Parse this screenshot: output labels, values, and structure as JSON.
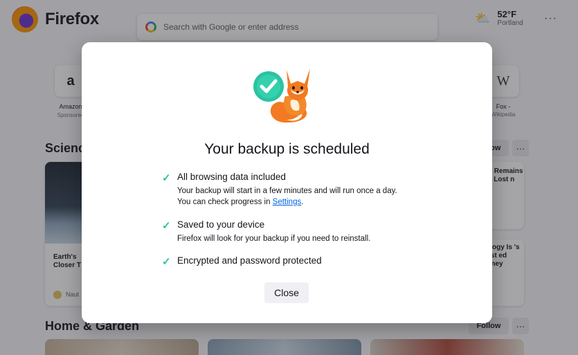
{
  "browser": {
    "name": "Firefox",
    "search_placeholder": "Search with Google or enter address",
    "weather": {
      "temp": "52°F",
      "city": "Portland"
    }
  },
  "shortcuts": [
    {
      "icon": "a",
      "label": "Amazon",
      "sub": "Sponsored"
    },
    {
      "icon": "W",
      "label": "Fox -",
      "sub": "Wikipedia"
    }
  ],
  "sections": [
    {
      "title": "Science",
      "follow": "Follow"
    },
    {
      "title": "Home & Garden",
      "follow": "Follow"
    }
  ],
  "cards": {
    "space_title": "Earth's Closer T",
    "space_source": "Naut",
    "right_top": "ted Remains d a Lost n",
    "right_bottom": "nology Is 's First ed Honey"
  },
  "dialog": {
    "title": "Your backup is scheduled",
    "items": [
      {
        "heading": "All browsing data included",
        "line1": "Your backup will start in a few minutes and will run once a day.",
        "line2_prefix": "You can check progress in ",
        "line2_link": "Settings",
        "line2_suffix": "."
      },
      {
        "heading": "Saved to your device",
        "line1": "Firefox will look for your backup if you need to reinstall."
      },
      {
        "heading": "Encrypted and password protected"
      }
    ],
    "close_label": "Close"
  },
  "colors": {
    "accent_check": "#2ac3a2",
    "link": "#0061e0",
    "fox_orange": "#f27a22"
  }
}
